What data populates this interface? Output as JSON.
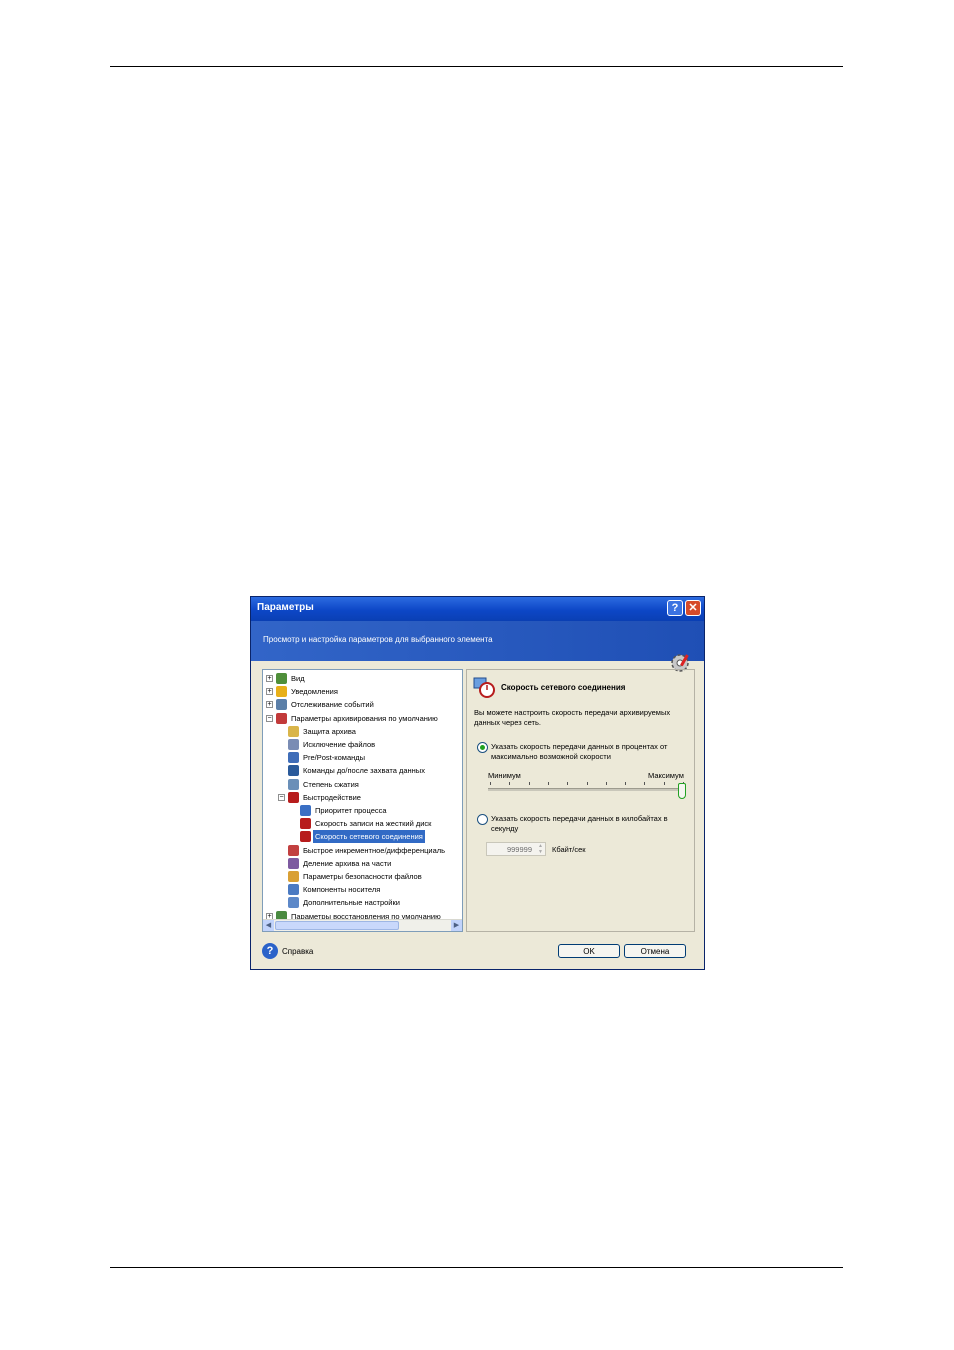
{
  "dialog": {
    "title": "Параметры",
    "help_button": "?",
    "close_button": "✕",
    "banner_text": "Просмотр и настройка параметров для выбранного элемента"
  },
  "tree": {
    "items": [
      {
        "label": "Вид",
        "expander": "+"
      },
      {
        "label": "Уведомления",
        "expander": "+"
      },
      {
        "label": "Отслеживание событий",
        "expander": "+"
      },
      {
        "label": "Параметры архивирования по умолчанию",
        "expander": "−"
      },
      {
        "label": "Защита архива"
      },
      {
        "label": "Исключение файлов"
      },
      {
        "label": "Pre/Post-команды"
      },
      {
        "label": "Команды до/после захвата данных"
      },
      {
        "label": "Степень сжатия"
      },
      {
        "label": "Быстродействие",
        "expander": "−"
      },
      {
        "label": "Приоритет процесса"
      },
      {
        "label": "Скорость записи на жесткий диск"
      },
      {
        "label": "Скорость сетевого соединения"
      },
      {
        "label": "Быстрое инкрементное/дифференциаль"
      },
      {
        "label": "Деление архива на части"
      },
      {
        "label": "Параметры безопасности файлов"
      },
      {
        "label": "Компоненты носителя"
      },
      {
        "label": "Дополнительные настройки"
      },
      {
        "label": "Параметры восстановления по умолчанию",
        "expander": "+"
      }
    ],
    "selected": "Скорость сетевого соединения"
  },
  "panel": {
    "title": "Скорость сетевого соединения",
    "description": "Вы можете настроить скорость передачи архивируемых данных через сеть.",
    "option_percent": "Указать скорость передачи данных в процентах от максимально возможной скорости",
    "option_percent_selected": true,
    "slider_min_label": "Минимум",
    "slider_max_label": "Максимум",
    "slider_value_fraction": 1.0,
    "option_kbps": "Указать скорость передачи данных в килобайтах в секунду",
    "option_kbps_selected": false,
    "kbps_value": "999999",
    "kbps_unit": "Кбайт/сек"
  },
  "footer": {
    "help_label": "Справка",
    "ok_label": "OK",
    "cancel_label": "Отмена"
  }
}
